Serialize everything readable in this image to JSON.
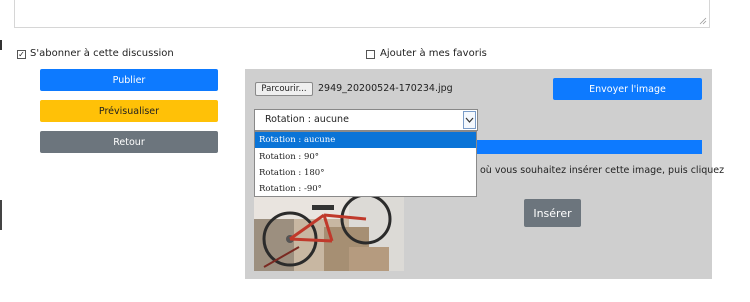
{
  "form": {
    "subscribe_label": "S'abonner à cette discussion",
    "subscribe_checked": true,
    "favorite_label": "Ajouter à mes favoris",
    "favorite_checked": false,
    "publish_label": "Publier",
    "preview_label": "Prévisualiser",
    "back_label": "Retour"
  },
  "upload": {
    "browse_label": "Parcourir...",
    "filename": "2949_20200524-170234.jpg",
    "send_label": "Envoyer l'image",
    "rotation_selected": "Rotation : aucune",
    "rotation_options": [
      "Rotation : aucune",
      "Rotation : 90°",
      "Rotation : 180°",
      "Rotation : -90°"
    ],
    "instruction": "où vous souhaitez insérer cette image, puis cliquez",
    "insert_label": "Insérer",
    "progress_percent": 100
  },
  "colors": {
    "primary": "#0d7aff",
    "warning": "#ffc107",
    "secondary": "#6c757d",
    "panel": "#cfcfcf",
    "selected_option": "#0a74d7"
  }
}
